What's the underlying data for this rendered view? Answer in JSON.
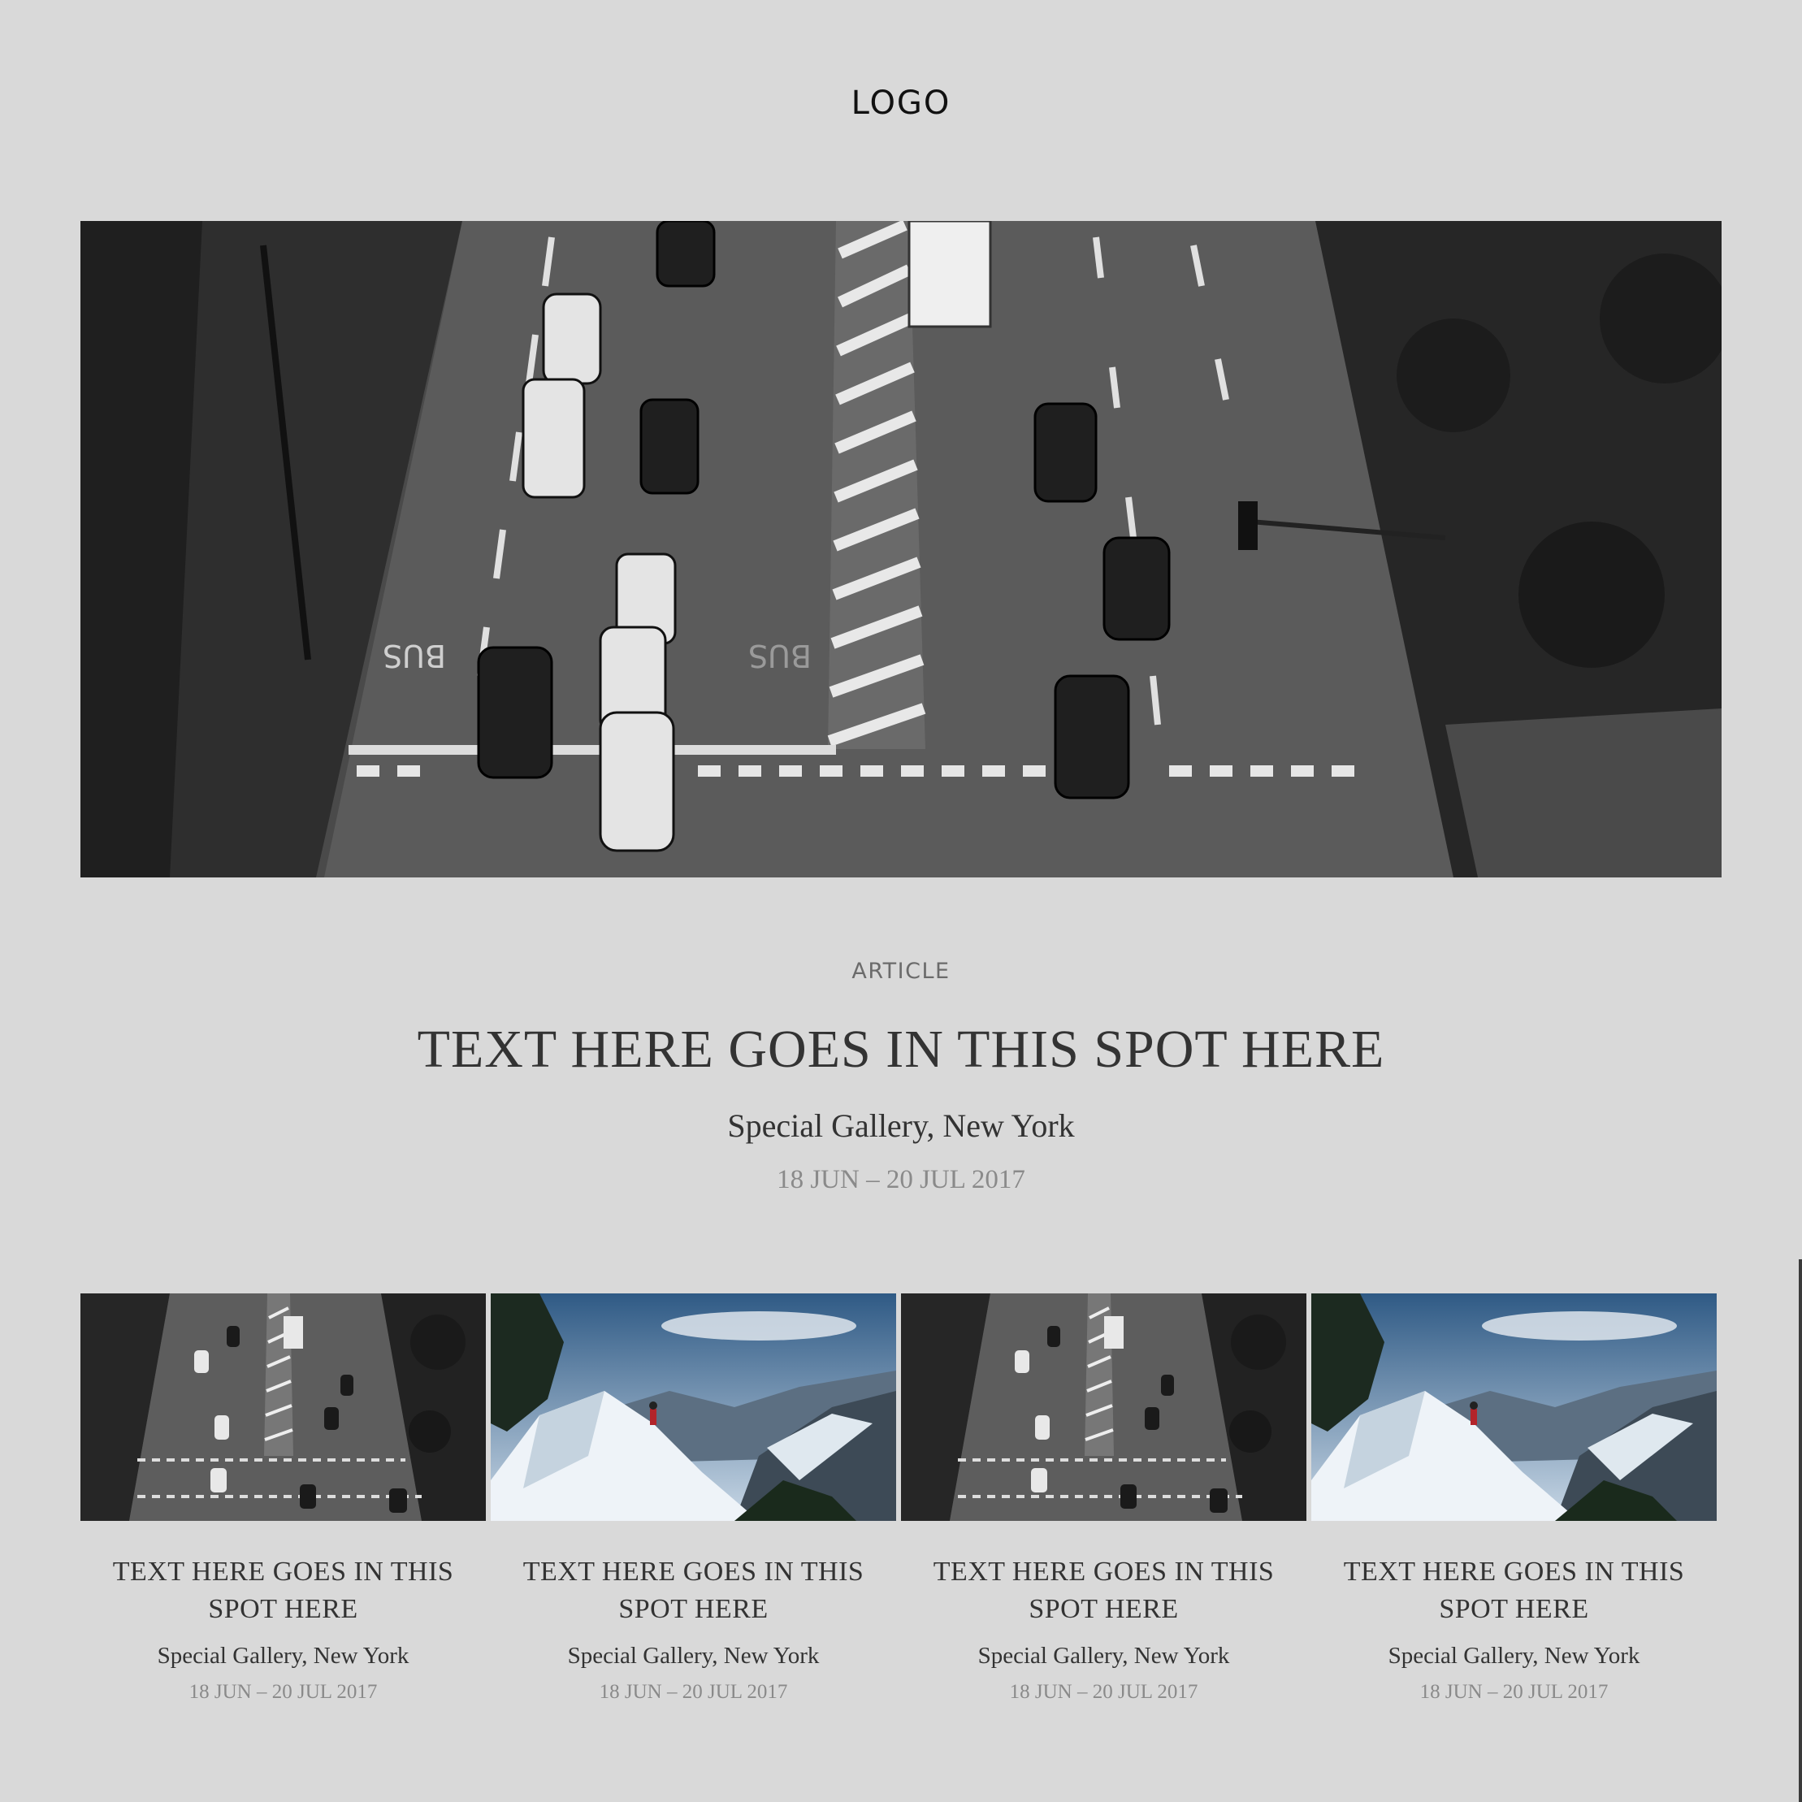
{
  "header": {
    "logo": "LOGO"
  },
  "hero": {
    "image_icon": "city-street-aerial-photo",
    "kicker": "ARTICLE",
    "title": "TEXT HERE GOES IN THIS SPOT HERE",
    "venue": "Special Gallery, New York",
    "date": "18 JUN – 20 JUL 2017"
  },
  "cards": [
    {
      "image_icon": "city-street-aerial-photo",
      "title": "TEXT HERE GOES IN THIS SPOT HERE",
      "venue": "Special Gallery, New York",
      "date": "18 JUN – 20 JUL 2017"
    },
    {
      "image_icon": "snowy-mountain-hiker-photo",
      "title": "TEXT HERE GOES IN THIS SPOT HERE",
      "venue": "Special Gallery, New York",
      "date": "18 JUN – 20 JUL 2017"
    },
    {
      "image_icon": "city-street-aerial-photo",
      "title": "TEXT HERE GOES IN THIS SPOT HERE",
      "venue": "Special Gallery, New York",
      "date": "18 JUN – 20 JUL 2017"
    },
    {
      "image_icon": "snowy-mountain-hiker-photo",
      "title": "TEXT HERE GOES IN THIS SPOT HERE",
      "venue": "Special Gallery, New York",
      "date": "18 JUN – 20 JUL 2017"
    }
  ],
  "colors": {
    "background": "#d9d9d9",
    "text": "#333333",
    "muted": "#8a8a8a"
  }
}
